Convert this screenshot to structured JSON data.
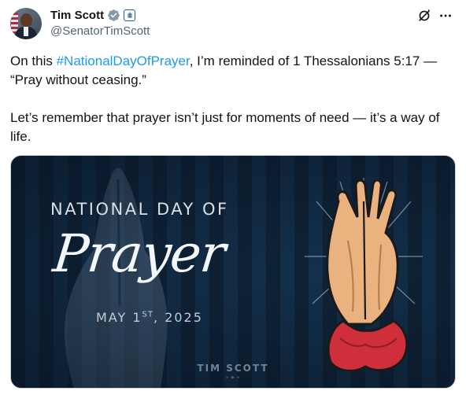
{
  "author": {
    "display_name": "Tim Scott",
    "handle": "@SenatorTimScott"
  },
  "tweet": {
    "text_before_hashtag": "On this ",
    "hashtag": "#NationalDayOfPrayer",
    "text_after_hashtag": ", I’m reminded of 1 Thessalonians 5:17 —",
    "quote": "“Pray without ceasing.”",
    "paragraph_2": "Let’s remember that prayer isn’t just for moments of need — it’s a way of life."
  },
  "media": {
    "heading": "NATIONAL DAY OF",
    "script_title": "Prayer",
    "date_main": "MAY 1",
    "date_sup": "ST",
    "date_year": ", 2025",
    "brand": "TIM SCOTT"
  },
  "icons": {
    "verified": "verified-badge-icon",
    "government": "government-badge-icon",
    "grok": "grok-icon",
    "more": "more-icon"
  },
  "colors": {
    "hashtag": "#1d9bf0",
    "verified": "#829aab",
    "text": "#0f1419",
    "secondary": "#536471"
  }
}
